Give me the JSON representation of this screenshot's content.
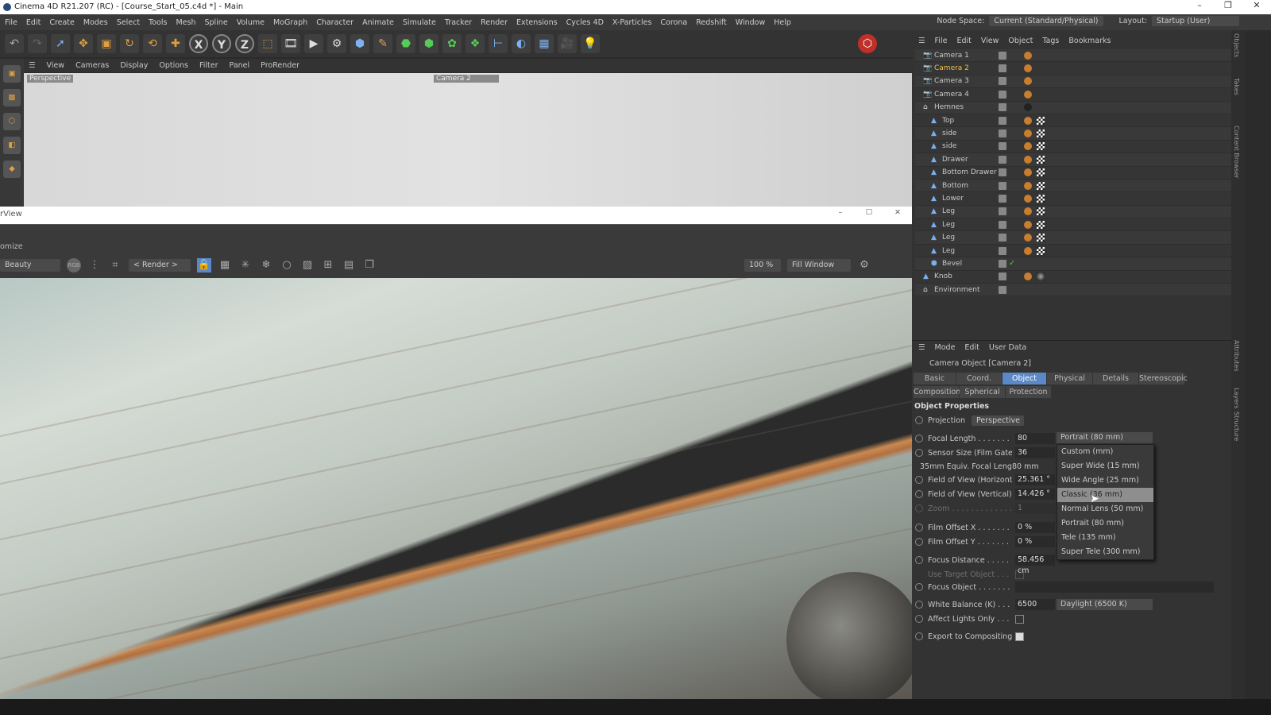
{
  "window": {
    "title": "Cinema 4D R21.207 (RC) - [Course_Start_05.c4d *] - Main",
    "min": "–",
    "max": "❐",
    "close": "✕"
  },
  "menu": [
    "File",
    "Edit",
    "Create",
    "Modes",
    "Select",
    "Tools",
    "Mesh",
    "Spline",
    "Volume",
    "MoGraph",
    "Character",
    "Animate",
    "Simulate",
    "Tracker",
    "Render",
    "Extensions",
    "Cycles 4D",
    "X-Particles",
    "Corona",
    "Redshift",
    "Window",
    "Help"
  ],
  "node_space": {
    "label": "Node Space:",
    "value": "Current (Standard/Physical)"
  },
  "layout": {
    "label": "Layout:",
    "value": "Startup (User)"
  },
  "viewport": {
    "menu": [
      "View",
      "Cameras",
      "Display",
      "Options",
      "Filter",
      "Panel",
      "ProRender"
    ],
    "label": "Perspective",
    "camera": "Camera 2"
  },
  "render_view": {
    "title": "rView",
    "menu": "omize",
    "pass": "Beauty",
    "rgb": "RGB",
    "render": "< Render >",
    "zoom": "100 %",
    "fit": "Fill Window",
    "min": "–",
    "max": "☐",
    "close": "✕"
  },
  "object_manager": {
    "menu": [
      "File",
      "Edit",
      "View",
      "Object",
      "Tags",
      "Bookmarks"
    ],
    "objects": [
      {
        "name": "Camera 1",
        "indent": 0,
        "type": "camera"
      },
      {
        "name": "Camera 2",
        "indent": 0,
        "type": "camera",
        "selected": true
      },
      {
        "name": "Camera 3",
        "indent": 0,
        "type": "camera"
      },
      {
        "name": "Camera 4",
        "indent": 0,
        "type": "camera"
      },
      {
        "name": "Hemnes",
        "indent": 0,
        "type": "null"
      },
      {
        "name": "Top",
        "indent": 1,
        "type": "poly"
      },
      {
        "name": "side",
        "indent": 1,
        "type": "poly"
      },
      {
        "name": "side",
        "indent": 1,
        "type": "poly"
      },
      {
        "name": "Drawer",
        "indent": 1,
        "type": "poly"
      },
      {
        "name": "Bottom Drawer",
        "indent": 1,
        "type": "poly"
      },
      {
        "name": "Bottom",
        "indent": 1,
        "type": "poly"
      },
      {
        "name": "Lower",
        "indent": 1,
        "type": "poly"
      },
      {
        "name": "Leg",
        "indent": 1,
        "type": "poly"
      },
      {
        "name": "Leg",
        "indent": 1,
        "type": "poly"
      },
      {
        "name": "Leg",
        "indent": 1,
        "type": "poly"
      },
      {
        "name": "Leg",
        "indent": 1,
        "type": "poly"
      },
      {
        "name": "Bevel",
        "indent": 1,
        "type": "deformer"
      },
      {
        "name": "Knob",
        "indent": 0,
        "type": "poly"
      },
      {
        "name": "Environment",
        "indent": 0,
        "type": "null"
      }
    ]
  },
  "attributes": {
    "menu": [
      "Mode",
      "Edit",
      "User Data"
    ],
    "title": "Camera Object [Camera 2]",
    "tabs_row1": [
      "Basic",
      "Coord.",
      "Object",
      "Physical",
      "Details",
      "Stereoscopic"
    ],
    "tabs_row2": [
      "Composition",
      "Spherical",
      "Protection"
    ],
    "active_tab": "Object",
    "section": "Object Properties",
    "projection": {
      "label": "Projection",
      "value": "Perspective"
    },
    "focal_length": {
      "label": "Focal Length . . . . . . . .",
      "value": "80",
      "preset": "Portrait (80 mm)"
    },
    "sensor": {
      "label": "Sensor Size (Film Gate) .",
      "value": "36"
    },
    "equiv": {
      "label": "35mm Equiv. Focal Length:",
      "value": "80 mm"
    },
    "fov_h": {
      "label": "Field of View (Horizontal)",
      "value": "25.361 °"
    },
    "fov_v": {
      "label": "Field of View (Vertical) . .",
      "value": "14.426 °"
    },
    "zoom": {
      "label": "Zoom . . . . . . . . . . . . .",
      "value": "1"
    },
    "offset_x": {
      "label": "Film Offset X . . . . . . . . .",
      "value": "0 %"
    },
    "offset_y": {
      "label": "Film Offset Y . . . . . . . . .",
      "value": "0 %"
    },
    "focus_distance": {
      "label": "Focus Distance . . . . . . .",
      "value": "58.456 cm"
    },
    "use_target": {
      "label": "Use Target Object . . . . ."
    },
    "focus_object": {
      "label": "Focus Object . . . . . . . . ."
    },
    "white_balance": {
      "label": "White Balance (K) . . . . .",
      "value": "6500",
      "preset": "Daylight (6500 K)"
    },
    "affect_lights": {
      "label": "Affect Lights Only . . . . .",
      "checked": false
    },
    "export_comp": {
      "label": "Export to Compositing . .",
      "checked": true
    },
    "preset_options": [
      "Custom (mm)",
      "Super Wide (15 mm)",
      "Wide Angle (25 mm)",
      "Classic (36 mm)",
      "Normal Lens (50 mm)",
      "Portrait (80 mm)",
      "Tele (135 mm)",
      "Super Tele (300 mm)"
    ],
    "highlighted_option": "Classic (36 mm)"
  },
  "side_tabs": [
    "Objects",
    "Takes",
    "Content Browser",
    "Attributes",
    "Layers",
    "Structure"
  ],
  "colors": {
    "accent": "#5b89c7",
    "selected_object": "#f0c040",
    "panel": "#333333"
  }
}
